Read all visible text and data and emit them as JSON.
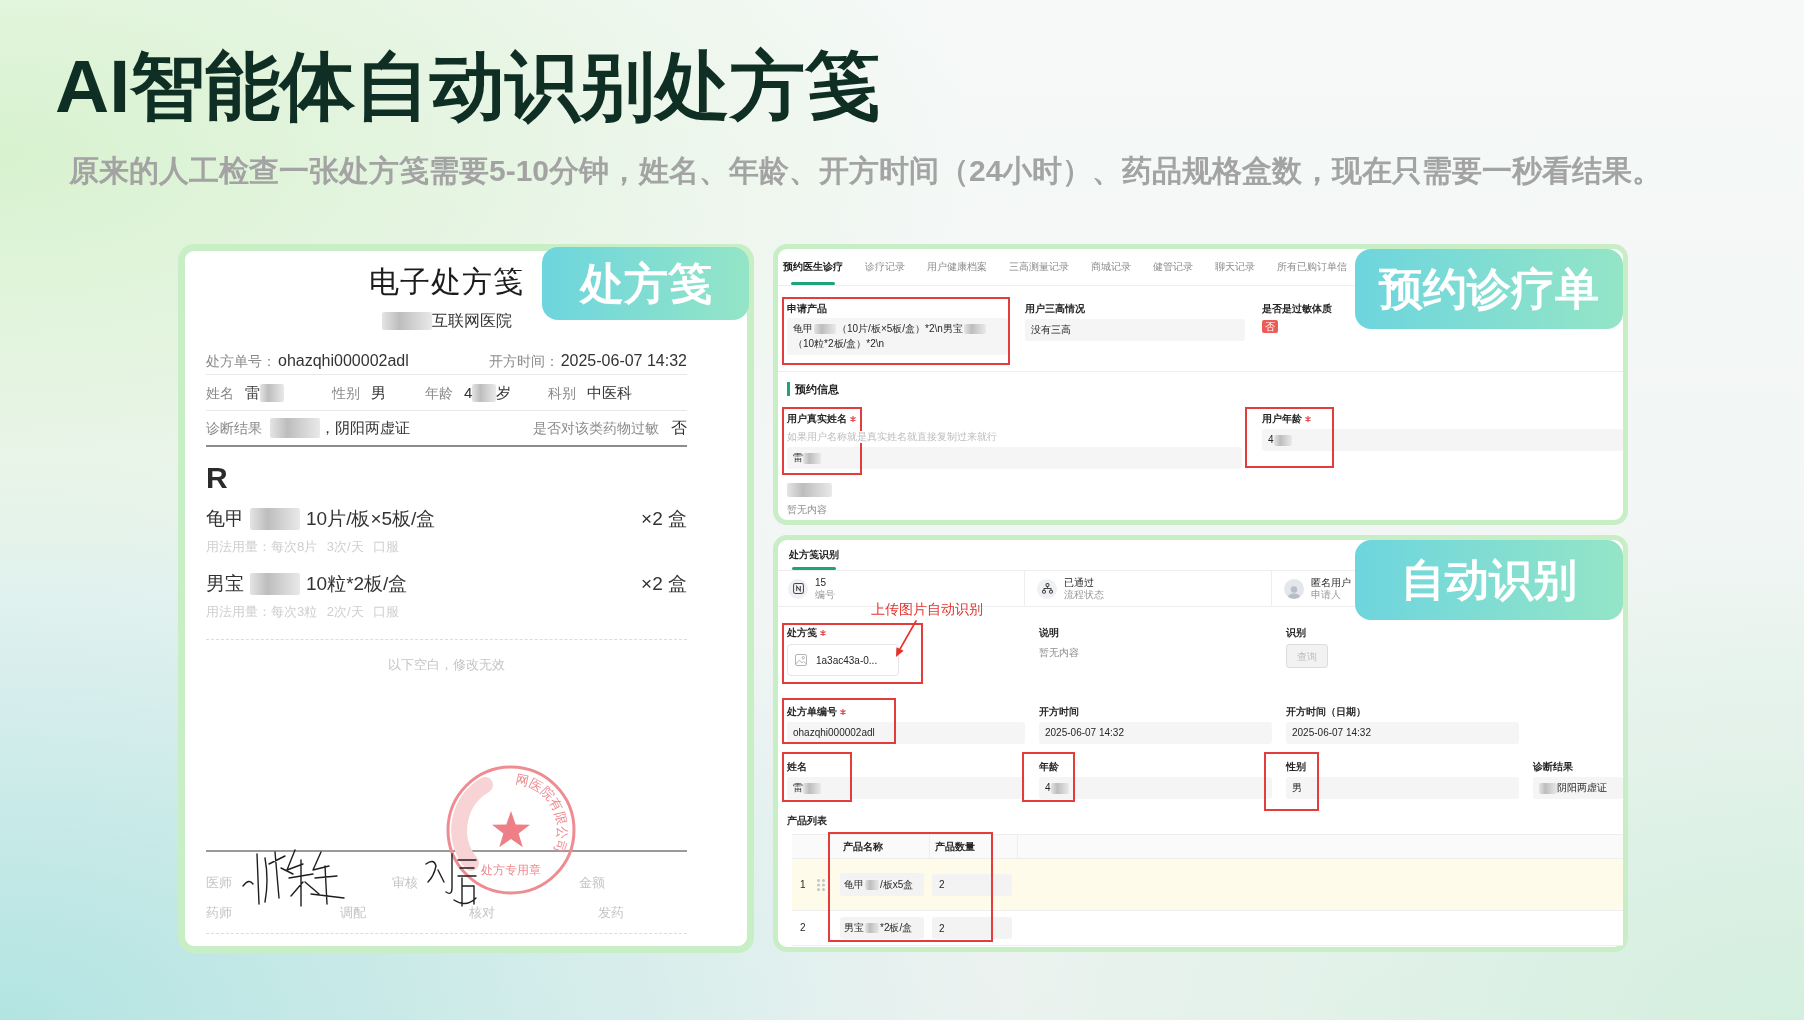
{
  "title": "AI智能体自动识别处方笺",
  "subtitle": "原来的人工检查一张处方笺需要5-10分钟，姓名、年龄、开方时间（24小时）、药品规格盒数，现在只需要一秒看结果。",
  "prescription": {
    "badge": "处方笺",
    "heading": "电子处方笺",
    "hospital": [
      {
        "kind": "redacted"
      },
      {
        "kind": "text",
        "text": "互联网医院"
      }
    ],
    "number": {
      "label": "处方单号：",
      "value": "ohazqhi000002adl"
    },
    "issued": {
      "label": "开方时间：",
      "value": "2025-06-07 14:32"
    },
    "patient": [
      {
        "label": "姓名",
        "value": [
          {
            "kind": "text",
            "text": "雷"
          },
          {
            "kind": "redacted"
          }
        ]
      },
      {
        "label": "性别",
        "value": [
          {
            "kind": "text",
            "text": "男"
          }
        ]
      },
      {
        "label": "年龄",
        "value": [
          {
            "kind": "text",
            "text": "4"
          },
          {
            "kind": "redacted"
          },
          {
            "kind": "text",
            "text": "岁"
          }
        ]
      },
      {
        "label": "科别",
        "value": [
          {
            "kind": "text",
            "text": "中医科"
          }
        ]
      }
    ],
    "diagnosis": {
      "label": "诊断结果",
      "value": [
        {
          "kind": "redacted"
        },
        {
          "kind": "text",
          "text": "，阴阳两虚证"
        }
      ]
    },
    "allergy": {
      "label": "是否对该类药物过敏",
      "value": "否"
    },
    "rx_symbol": "R",
    "drugs": [
      {
        "name": [
          {
            "kind": "text",
            "text": "龟甲"
          },
          {
            "kind": "redacted"
          },
          {
            "kind": "text",
            "text": "10片/板×5板/盒"
          }
        ],
        "quantity": "×2 盒",
        "usage": "用法用量：每次8片 3次/天 口服"
      },
      {
        "name": [
          {
            "kind": "text",
            "text": "男宝"
          },
          {
            "kind": "redacted"
          },
          {
            "kind": "text",
            "text": "10粒*2板/盒"
          }
        ],
        "quantity": "×2 盒",
        "usage": "用法用量：每次3粒 2次/天 口服"
      }
    ],
    "blank_note": "以下空白，修改无效",
    "stamp": {
      "arc_text": "网医院有限公司",
      "label": "处方专用章"
    },
    "sign_rows": [
      [
        "医师",
        "审核",
        "金额"
      ],
      [
        "药师",
        "调配",
        "核对",
        "发药"
      ]
    ]
  },
  "appointment": {
    "badge": "预约诊疗单",
    "tabs": [
      {
        "label": "预约医生诊疗",
        "selected": true
      },
      {
        "label": "诊疗记录",
        "selected": false
      },
      {
        "label": "用户健康档案",
        "selected": false
      },
      {
        "label": "三高测量记录",
        "selected": false
      },
      {
        "label": "商城记录",
        "selected": false
      },
      {
        "label": "健管记录",
        "selected": false
      },
      {
        "label": "聊天记录",
        "selected": false
      },
      {
        "label": "所有已购订单信",
        "selected": false
      }
    ],
    "top_fields": [
      {
        "kind": "textarea",
        "label": "申请产品",
        "required": false,
        "highlighted": true,
        "value": [
          {
            "kind": "text",
            "text": "龟甲"
          },
          {
            "kind": "redacted"
          },
          {
            "kind": "text",
            "text": "（10片/板×5板/盒）*2\\n男宝"
          },
          {
            "kind": "redacted"
          },
          {
            "kind": "text",
            "text": "（10粒*2板/盒）*2\\n"
          }
        ]
      },
      {
        "kind": "input",
        "label": "用户三高情况",
        "required": false,
        "highlighted": false,
        "value": [
          {
            "kind": "text",
            "text": "没有三高"
          }
        ]
      },
      {
        "kind": "tag",
        "label": "是否是过敏体质",
        "required": false,
        "highlighted": false,
        "value": [
          {
            "kind": "text",
            "text": "否"
          }
        ]
      }
    ],
    "section_title": "预约信息",
    "info_fields": [
      {
        "kind": "input",
        "label": "用户真实姓名",
        "required": true,
        "highlighted": true,
        "help": "如果用户名称就是真实姓名就直接复制过来就行",
        "value": [
          {
            "kind": "text",
            "text": "雷"
          },
          {
            "kind": "redacted"
          }
        ]
      },
      {
        "kind": "input",
        "label": "用户年龄",
        "required": true,
        "highlighted": true,
        "value": [
          {
            "kind": "text",
            "text": "4"
          },
          {
            "kind": "redacted"
          }
        ]
      }
    ],
    "extra": {
      "label": [
        {
          "kind": "redacted"
        }
      ],
      "value": "暂无内容"
    }
  },
  "recognition": {
    "badge": "自动识别",
    "tabs": [
      {
        "label": "处方笺识别",
        "selected": true
      }
    ],
    "summary": [
      {
        "kind": "number",
        "value": "15",
        "caption": "编号"
      },
      {
        "kind": "status",
        "value": "已通过",
        "caption": "流程状态"
      },
      {
        "kind": "applicant",
        "value": "匿名用户",
        "caption": "申请人"
      }
    ],
    "annotation": "上传图片自动识别",
    "rows": [
      [
        {
          "kind": "file",
          "label": "处方笺",
          "required": true,
          "highlighted": true,
          "text": "1a3ac43a-0..."
        },
        {
          "kind": "note",
          "label": "说明",
          "required": false,
          "highlighted": false,
          "value": [
            {
              "kind": "text",
              "text": "暂无内容"
            }
          ]
        },
        {
          "kind": "button",
          "label": "识别",
          "required": false,
          "highlighted": false,
          "text": "查询",
          "disabled": true
        }
      ],
      [
        {
          "kind": "input",
          "label": "处方单编号",
          "required": true,
          "highlighted": true,
          "value": [
            {
              "kind": "text",
              "text": "ohazqhi000002adl"
            }
          ]
        },
        {
          "kind": "input",
          "label": "开方时间",
          "required": false,
          "highlighted": false,
          "value": [
            {
              "kind": "text",
              "text": "2025-06-07 14:32"
            }
          ]
        },
        {
          "kind": "input",
          "label": "开方时间（日期）",
          "required": false,
          "highlighted": false,
          "value": [
            {
              "kind": "text",
              "text": "2025-06-07 14:32"
            }
          ]
        }
      ],
      [
        {
          "kind": "input",
          "label": "姓名",
          "required": false,
          "highlighted": true,
          "value": [
            {
              "kind": "text",
              "text": "雷"
            },
            {
              "kind": "redacted"
            }
          ]
        },
        {
          "kind": "input",
          "label": "年龄",
          "required": false,
          "highlighted": true,
          "value": [
            {
              "kind": "text",
              "text": "4"
            },
            {
              "kind": "redacted"
            }
          ]
        },
        {
          "kind": "input",
          "label": "性别",
          "required": false,
          "highlighted": true,
          "value": [
            {
              "kind": "text",
              "text": "男"
            }
          ]
        },
        {
          "kind": "input",
          "label": "诊断结果",
          "required": false,
          "highlighted": false,
          "value": [
            {
              "kind": "redacted"
            },
            {
              "kind": "text",
              "text": "阴阳两虚证"
            }
          ]
        }
      ]
    ],
    "products": {
      "label": "产品列表",
      "highlighted": true,
      "columns": [
        "产品名称",
        "产品数量"
      ],
      "rows": [
        {
          "index": "1",
          "selected": true,
          "name": [
            {
              "kind": "text",
              "text": "龟甲"
            },
            {
              "kind": "redacted"
            },
            {
              "kind": "text",
              "text": "/板x5盒"
            }
          ],
          "quantity": "2"
        },
        {
          "index": "2",
          "selected": false,
          "name": [
            {
              "kind": "text",
              "text": "男宝"
            },
            {
              "kind": "redacted"
            },
            {
              "kind": "text",
              "text": "*2板/盒"
            }
          ],
          "quantity": "2"
        }
      ]
    }
  }
}
